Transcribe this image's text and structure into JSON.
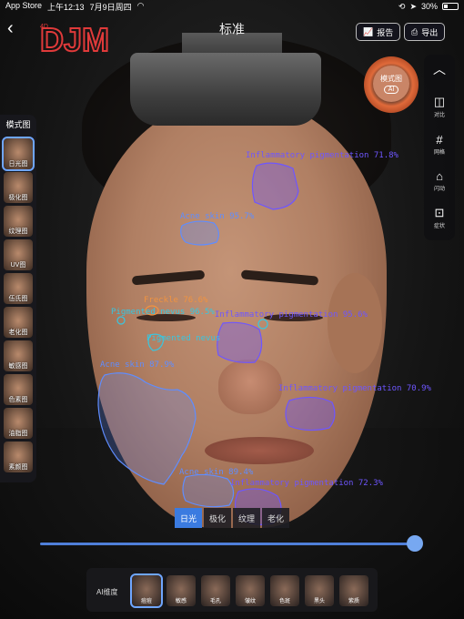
{
  "status": {
    "carrier": "App Store",
    "time": "上午12:13",
    "date": "7月9日周四",
    "battery": "30%"
  },
  "brand": {
    "logo_text": "DJM",
    "logo_small": "4D"
  },
  "header": {
    "title": "标准",
    "report_label": "报告",
    "export_label": "导出"
  },
  "left_panel": {
    "title": "模式图",
    "items": [
      "日光图",
      "极化图",
      "纹理图",
      "UV图",
      "伍氏图",
      "老化图",
      "敏感图",
      "色素图",
      "油脂图",
      "素颜图"
    ],
    "active_index": 0
  },
  "right_toolbar": {
    "mode_badge": "模式图",
    "mode_ai": "AI",
    "items": [
      "对比",
      "网格",
      "闪动",
      "症状"
    ]
  },
  "detections": [
    {
      "label": "Inflammatory pigmentation 71.8%",
      "color": "purple"
    },
    {
      "label": "Acne skin 95.7%",
      "color": "blue"
    },
    {
      "label": "Freckle 76.6%",
      "color": "orange"
    },
    {
      "label": "Pigmented nevus 96.5%",
      "color": "cyan"
    },
    {
      "label": "Inflammatory pigmentation 95.6%",
      "color": "purple"
    },
    {
      "label": "Pigmented nevus",
      "color": "cyan"
    },
    {
      "label": "Acne skin 87.9%",
      "color": "blue"
    },
    {
      "label": "Inflammatory pigmentation 70.9%",
      "color": "purple"
    },
    {
      "label": "Acne skin 89.4%",
      "color": "blue"
    },
    {
      "label": "Inflammatory pigmentation 72.3%",
      "color": "purple"
    }
  ],
  "light_tabs": {
    "items": [
      "日光",
      "极化",
      "纹理",
      "老化"
    ],
    "active_index": 0
  },
  "slider": {
    "value": 1.0
  },
  "ai_bar": {
    "label": "AI维度",
    "items": [
      "痘痘",
      "敏感",
      "毛孔",
      "皱纹",
      "色斑",
      "黑头",
      "紫质"
    ],
    "active_index": 0
  },
  "colors": {
    "accent": "#3b7be0",
    "purple": "#6e56ff",
    "blue": "#5f8dff",
    "cyan": "#38c6e0",
    "orange": "#f09340",
    "logo_red": "#e03a3a"
  }
}
